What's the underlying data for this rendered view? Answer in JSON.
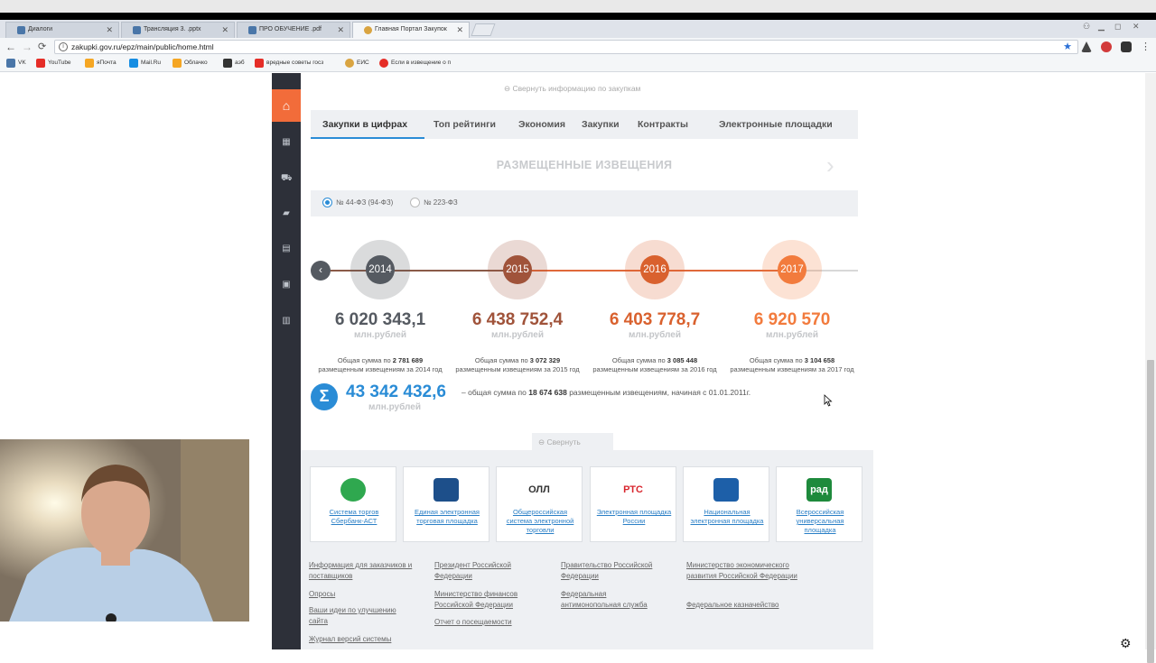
{
  "browser": {
    "tabs": [
      {
        "label": "Диалоги",
        "color": "#4a76a8"
      },
      {
        "label": "Трансляция 3. .pptx",
        "color": "#4a76a8"
      },
      {
        "label": "ПРО ОБУЧЕНИЕ .pdf",
        "color": "#4a76a8"
      },
      {
        "label": "Главная Портал Закупок",
        "color": "#d9a441"
      }
    ],
    "url": "zakupki.gov.ru/epz/main/public/home.html",
    "bookmarks": [
      {
        "label": "VK",
        "color": "#4a76a8"
      },
      {
        "label": "YouTube",
        "color": "#e52d27"
      },
      {
        "label": "яПочта",
        "color": "#f5a623"
      },
      {
        "label": "Mail.Ru",
        "color": "#168de2"
      },
      {
        "label": "Облачко",
        "color": "#f5a623"
      },
      {
        "label": "аэб",
        "color": "#333333"
      },
      {
        "label": "вредные советы госз",
        "color": "#e52d27"
      },
      {
        "label": "ЕИС",
        "color": "#d9a441"
      },
      {
        "label": "Если в извещение о п",
        "color": "#e52d27"
      }
    ]
  },
  "portal": {
    "collapse_top": "Свернуть информацию по закупкам",
    "tabs": [
      "Закупки в цифрах",
      "Топ рейтинги",
      "Экономия",
      "Закупки",
      "Контракты",
      "Электронные площадки"
    ],
    "active_tab": "Закупки в цифрах",
    "section_title": "РАЗМЕЩЕННЫЕ ИЗВЕЩЕНИЯ",
    "radio_options": [
      {
        "label": "№ 44-ФЗ (94-ФЗ)",
        "selected": true
      },
      {
        "label": "№ 223-ФЗ",
        "selected": false
      }
    ],
    "years": [
      {
        "year": "2014",
        "amount": "6 020 343,1",
        "unit": "млн.рублей",
        "desc_pre": "Общая сумма по",
        "count": "2 781 689",
        "desc_post": "размещенным извещениям за 2014 год",
        "color": "#555a61"
      },
      {
        "year": "2015",
        "amount": "6 438 752,4",
        "unit": "млн.рублей",
        "desc_pre": "Общая сумма по",
        "count": "3 072 329",
        "desc_post": "размещенным извещениям за 2015 год",
        "color": "#a0533a"
      },
      {
        "year": "2016",
        "amount": "6 403 778,7",
        "unit": "млн.рублей",
        "desc_pre": "Общая сумма по",
        "count": "3 085 448",
        "desc_post": "размещенным извещениям за 2016 год",
        "color": "#d9612e"
      },
      {
        "year": "2017",
        "amount": "6 920 570",
        "unit": "млн.рублей",
        "desc_pre": "Общая сумма по",
        "count": "3 104 658",
        "desc_post": "размещенным извещениям за 2017 год",
        "color": "#f27b3d"
      }
    ],
    "total": {
      "symbol": "Σ",
      "amount": "43 342 432,6",
      "unit": "млн.рублей",
      "desc_pre": "– общая сумма по",
      "count": "18 674 638",
      "desc_post": "размещенным извещениям, начиная с 01.01.2011г."
    },
    "collapse_btn": "Свернуть",
    "platforms": [
      {
        "label": "Система торгов Сбербанк-АСТ",
        "logo": "",
        "color": "#2fa84f"
      },
      {
        "label": "Единая электронная торговая площадка",
        "logo": "",
        "color": "#1d4f8a"
      },
      {
        "label": "Общероссийская система электронной торговли",
        "logo": "ОЛЛ",
        "color": "#ffffff"
      },
      {
        "label": "Электронная площадка России",
        "logo": "РТС",
        "color": "#ffffff"
      },
      {
        "label": "Национальная электронная площадка",
        "logo": "",
        "color": "#1d5fa8"
      },
      {
        "label": "Всероссийская универсальная площадка",
        "logo": "рад",
        "color": "#1e8a3c"
      }
    ],
    "footer_links": [
      [
        "Информация для заказчиков и поставщиков",
        "Опросы",
        "Ваши идеи по улучшению сайта",
        "Журнал версий системы"
      ],
      [
        "Президент Российской Федерации",
        "Министерство финансов Российской Федерации",
        "Отчет о посещаемости"
      ],
      [
        "Правительство Российской Федерации",
        "Федеральная антимонопольная служба"
      ],
      [
        "Министерство экономического развития Российской Федерации",
        "Федеральное казначейство"
      ]
    ]
  }
}
